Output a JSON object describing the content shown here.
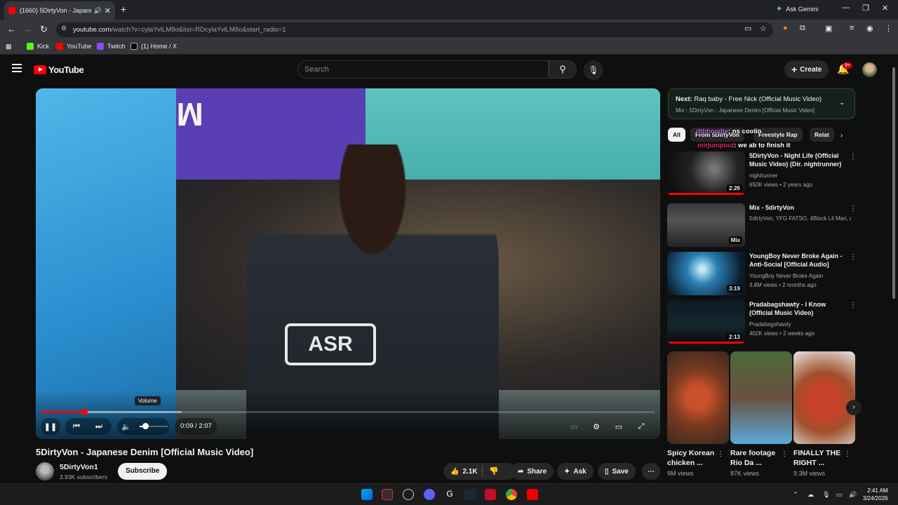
{
  "browser": {
    "tab_title": "(1660) 5DirtyVon - Japanese",
    "ask_gemini": "Ask Gemini",
    "url_host": "youtube.com",
    "url_rest": "/watch?v=cylaYvlLM8o&list=RDcylaYvlLM8o&start_radio=1",
    "bookmarks": [
      "Kick",
      "YouTube",
      "Twitch",
      "(1) Home / X"
    ]
  },
  "youtube": {
    "logo": "YouTube",
    "search_placeholder": "Search",
    "create_label": "Create",
    "notif_badge": "9+"
  },
  "player": {
    "volume_tooltip": "Volume",
    "time": "0:09 / 2:07",
    "progress_fraction": 0.07,
    "volume_fraction": 0.2,
    "shirt_text": "ASR",
    "sign_text": "MASS"
  },
  "video": {
    "title": "5DirtyVon - Japanese Denim [Official Music Video]",
    "channel": "5DirtyVon1",
    "subscribers": "3.93K subscribers",
    "subscribe_label": "Subscribe",
    "likes": "2.1K",
    "share_label": "Share",
    "ask_label": "Ask",
    "save_label": "Save"
  },
  "sidebar": {
    "next_prefix": "Next:",
    "next_title": "Raq baby - Free Nick (Official Music Video)",
    "mix_label": "Mix - 5DirtyVon - Japanese Denim [Official Music Video]",
    "chips": [
      "All",
      "From 5DirtyVon",
      "Freestyle Rap",
      "Relat"
    ],
    "chat": [
      {
        "user": "dtbhoodie",
        "text": ": ns coolin"
      },
      {
        "user": "mirjumpout",
        "text": ": we ab to finish it"
      }
    ],
    "recommendations": [
      {
        "title": "5DirtyVon - Night Life (Official Music Video) (Dir. nightrunner)",
        "channel": "nightrunner",
        "meta": "650K views • 2 years ago",
        "duration": "2:26"
      },
      {
        "title": "Mix - 5dirtyVon",
        "channel": "5dirtyVon, YFG FATSO, 4Block Lil Mari, and more",
        "meta": "",
        "duration": "Mix"
      },
      {
        "title": "YoungBoy Never Broke Again - Anti-Social [Official Audio]",
        "channel": "YoungBoy Never Broke Again",
        "meta": "3.8M views • 2 months ago",
        "duration": "3:19"
      },
      {
        "title": "Pradabagshawty - I Know (Official Music Video)",
        "channel": "Pradabagshawty",
        "meta": "402K views • 2 weeks ago",
        "duration": "2:13"
      }
    ],
    "shorts": [
      {
        "title": "Spicy Korean chicken ...",
        "views": "9M views"
      },
      {
        "title": "Rare footage Rio Da ...",
        "views": "87K views"
      },
      {
        "title": "FINALLY THE RIGHT ...",
        "views": "9.3M views"
      }
    ]
  },
  "taskbar": {
    "time": "2:41 AM",
    "date": "3/24/2026"
  }
}
